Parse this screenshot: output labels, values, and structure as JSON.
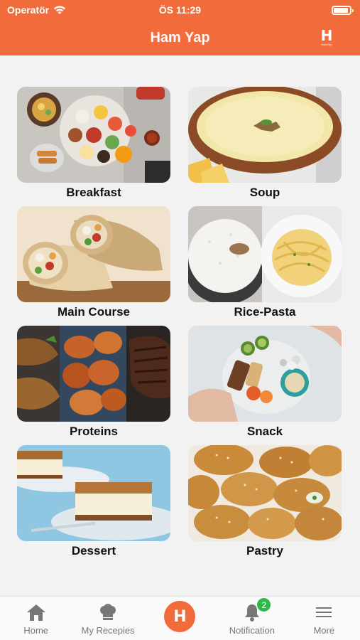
{
  "status_bar": {
    "carrier": "Operatör",
    "time": "ÖS 11:29"
  },
  "header": {
    "title": "Ham Yap",
    "logo_letter": "H",
    "logo_subtext": "HamYap"
  },
  "categories": [
    {
      "label": "Breakfast",
      "icon": "breakfast-image"
    },
    {
      "label": "Soup",
      "icon": "soup-image"
    },
    {
      "label": "Main Course",
      "icon": "wrap-image"
    },
    {
      "label": "Rice-Pasta",
      "icon": "rice-pasta-image"
    },
    {
      "label": "Proteins",
      "icon": "proteins-image"
    },
    {
      "label": "Snack",
      "icon": "snack-image"
    },
    {
      "label": "Dessert",
      "icon": "dessert-image"
    },
    {
      "label": "Pastry",
      "icon": "pastry-image"
    }
  ],
  "tab_bar": {
    "home": "Home",
    "recipes": "My Recepies",
    "center_letter": "H",
    "notification": "Notification",
    "notification_count": "2",
    "more": "More"
  },
  "colors": {
    "brand": "#f26b3a",
    "badge": "#2db84a",
    "background": "#f2f2f2"
  }
}
